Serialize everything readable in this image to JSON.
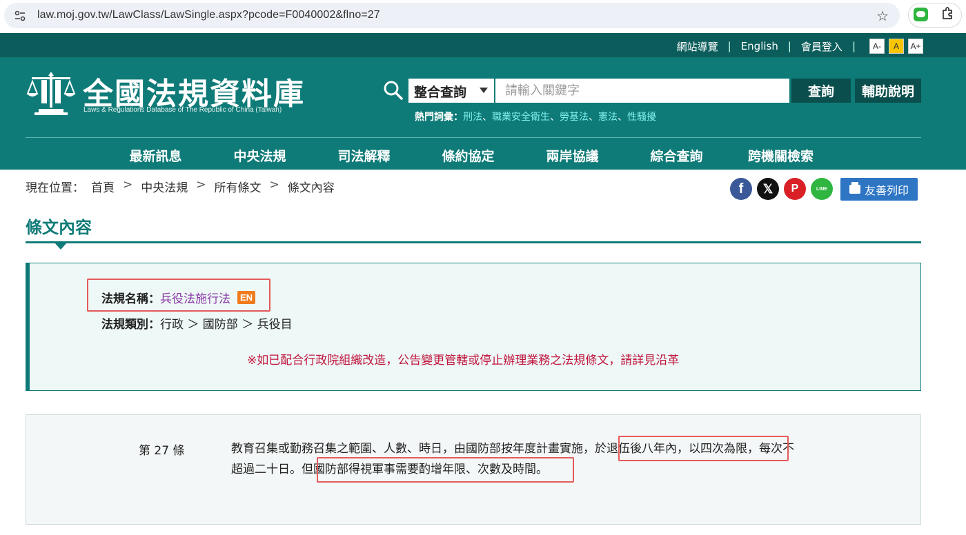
{
  "browser": {
    "url": "law.moj.gov.tw/LawClass/LawSingle.aspx?pcode=F0040002&flno=27",
    "icons": [
      "site-info-icon",
      "star-icon",
      "line-extension-icon",
      "puzzle-extension-icon"
    ]
  },
  "topbar": {
    "sitemap": "網站導覽",
    "english": "English",
    "member_login": "會員登入",
    "font_small": "A-",
    "font_mid": "A",
    "font_large": "A+"
  },
  "logo": {
    "title": "全國法規資料庫",
    "subtitle": "Laws & Regulations Database of The Republic of China (Taiwan)"
  },
  "search": {
    "scope": "整合查詢",
    "placeholder": "請輸入關鍵字",
    "button": "查詢",
    "help": "輔助說明",
    "hot_label": "熱門詞彙：",
    "hot_words": [
      "刑法",
      "職業安全衛生",
      "勞基法",
      "憲法",
      "性騷擾"
    ]
  },
  "nav": [
    "最新訊息",
    "中央法規",
    "司法解釋",
    "條約協定",
    "兩岸協議",
    "綜合查詢",
    "跨機關檢索"
  ],
  "breadcrumb": {
    "prefix": "現在位置：",
    "items": [
      "首頁",
      "中央法規",
      "所有條文",
      "條文內容"
    ]
  },
  "share": {
    "facebook": "f",
    "x": "𝕏",
    "plurk": "P",
    "line": "LINE",
    "print": "友善列印"
  },
  "page_title": "條文內容",
  "law": {
    "name_label": "法規名稱：",
    "name": "兵役法施行法",
    "en_badge": "EN",
    "category_label": "法規類別：",
    "category": "行政 ＞ 國防部 ＞ 兵役目",
    "note": "※如已配合行政院組織改造，公告變更管轄或停止辦理業務之法規條文，請詳見沿革"
  },
  "article": {
    "number": "第 27 條",
    "text_line1": "教育召集或勤務召集之範圍、人數、時日，由國防部按年度計畫實施，於退伍後八年內，以四次為限，每次不",
    "text_line2": "超過二十日。但國防部得視軍事需要酌增年限、次數及時間。"
  },
  "colors": {
    "brand_teal": "#0f7b78",
    "topline_teal": "#0b5d5b",
    "highlight_red": "#e45a5a",
    "note_red": "#c0143c",
    "law_name_purple": "#8a3aa6",
    "print_blue": "#2e75c4"
  }
}
